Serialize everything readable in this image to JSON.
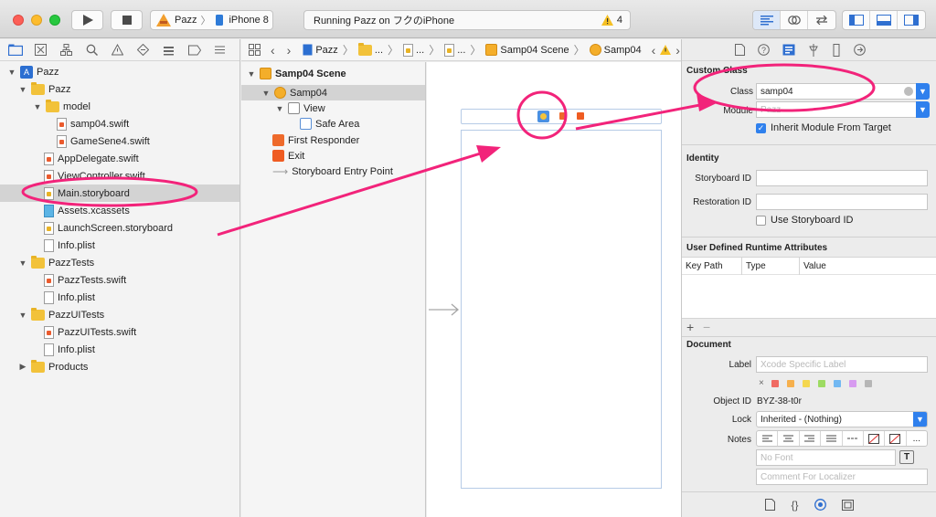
{
  "toolbar": {
    "scheme_name": "Pazz",
    "device_name": "iPhone 8",
    "status_text": "Running Pazz on フクのiPhone",
    "warning_count": "4"
  },
  "navigator": {
    "items": [
      {
        "label": "Pazz",
        "kind": "project"
      },
      {
        "label": "Pazz",
        "kind": "folder"
      },
      {
        "label": "model",
        "kind": "folder"
      },
      {
        "label": "samp04.swift",
        "kind": "swift"
      },
      {
        "label": "GameSene4.swift",
        "kind": "swift"
      },
      {
        "label": "AppDelegate.swift",
        "kind": "swift"
      },
      {
        "label": "ViewController.swift",
        "kind": "swift"
      },
      {
        "label": "Main.storyboard",
        "kind": "storyboard"
      },
      {
        "label": "Assets.xcassets",
        "kind": "assets"
      },
      {
        "label": "LaunchScreen.storyboard",
        "kind": "storyboard"
      },
      {
        "label": "Info.plist",
        "kind": "plist"
      },
      {
        "label": "PazzTests",
        "kind": "folder"
      },
      {
        "label": "PazzTests.swift",
        "kind": "swift"
      },
      {
        "label": "Info.plist",
        "kind": "plist"
      },
      {
        "label": "PazzUITests",
        "kind": "folder"
      },
      {
        "label": "PazzUITests.swift",
        "kind": "swift"
      },
      {
        "label": "Info.plist",
        "kind": "plist"
      },
      {
        "label": "Products",
        "kind": "folder"
      }
    ]
  },
  "jumpbar": {
    "items": [
      "Pazz",
      "...",
      "...",
      "...",
      "Samp04 Scene",
      "Samp04"
    ]
  },
  "outline": {
    "items": [
      "Samp04 Scene",
      "Samp04",
      "View",
      "Safe Area",
      "First Responder",
      "Exit",
      "Storyboard Entry Point"
    ]
  },
  "inspector": {
    "custom_class": {
      "title": "Custom Class",
      "class_label": "Class",
      "class_value": "samp04",
      "module_label": "Module",
      "module_value": "Pazz",
      "inherit_label": "Inherit Module From Target"
    },
    "identity": {
      "title": "Identity",
      "storyboard_id_label": "Storyboard ID",
      "restoration_id_label": "Restoration ID",
      "use_storyboard_id_label": "Use Storyboard ID"
    },
    "runtime": {
      "title": "User Defined Runtime Attributes",
      "columns": [
        "Key Path",
        "Type",
        "Value"
      ]
    },
    "document": {
      "title": "Document",
      "label_label": "Label",
      "label_placeholder": "Xcode Specific Label",
      "object_id_label": "Object ID",
      "object_id_value": "BYZ-38-t0r",
      "lock_label": "Lock",
      "lock_value": "Inherited - (Nothing)",
      "notes_label": "Notes",
      "font_placeholder": "No Font",
      "comment_placeholder": "Comment For Localizer",
      "notes_more": "..."
    },
    "swatch_colors": [
      "#f06a63",
      "#f6b04d",
      "#f4d74f",
      "#9ddb62",
      "#72b8f2",
      "#d79bf0",
      "#b6b6b6"
    ]
  },
  "annotation_color": "#f2237a"
}
